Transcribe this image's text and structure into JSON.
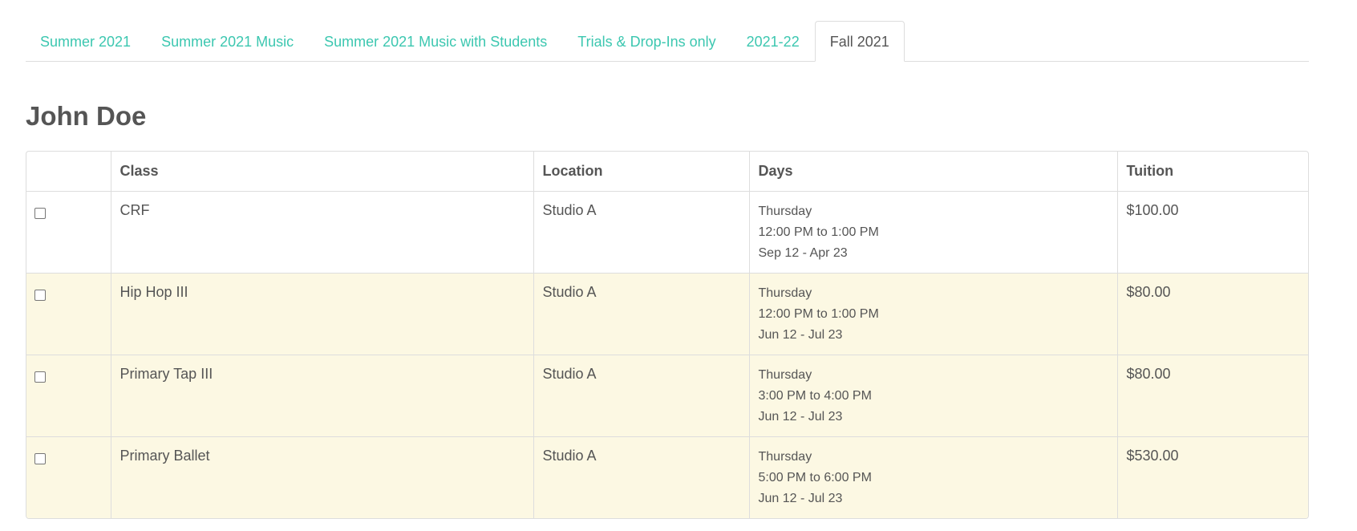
{
  "tabs": [
    {
      "label": "Summer 2021",
      "active": false
    },
    {
      "label": "Summer 2021 Music",
      "active": false
    },
    {
      "label": "Summer 2021 Music with Students",
      "active": false
    },
    {
      "label": "Trials & Drop-Ins only",
      "active": false
    },
    {
      "label": "2021-22",
      "active": false
    },
    {
      "label": "Fall 2021",
      "active": true
    }
  ],
  "student": {
    "name": "John Doe"
  },
  "table": {
    "headers": {
      "check": "",
      "class": "Class",
      "location": "Location",
      "days": "Days",
      "tuition": "Tuition"
    },
    "rows": [
      {
        "class": "CRF",
        "location": "Studio A",
        "day": "Thursday",
        "time": "12:00 PM to 1:00 PM",
        "dates": "Sep 12 - Apr 23",
        "tuition": "$100.00",
        "checked": false,
        "highlighted": false
      },
      {
        "class": "Hip Hop III",
        "location": "Studio A",
        "day": "Thursday",
        "time": "12:00 PM to 1:00 PM",
        "dates": "Jun 12 - Jul 23",
        "tuition": "$80.00",
        "checked": false,
        "highlighted": true
      },
      {
        "class": "Primary Tap III",
        "location": "Studio A",
        "day": "Thursday",
        "time": "3:00 PM to 4:00 PM",
        "dates": "Jun 12 - Jul 23",
        "tuition": "$80.00",
        "checked": false,
        "highlighted": true
      },
      {
        "class": "Primary Ballet",
        "location": "Studio A",
        "day": "Thursday",
        "time": "5:00 PM to 6:00 PM",
        "dates": "Jun 12 - Jul 23",
        "tuition": "$530.00",
        "checked": false,
        "highlighted": true
      }
    ]
  },
  "colors": {
    "accent": "#3cc7b0",
    "text": "#555555",
    "border": "#dddddd",
    "row_highlight": "#fcf8e3"
  }
}
